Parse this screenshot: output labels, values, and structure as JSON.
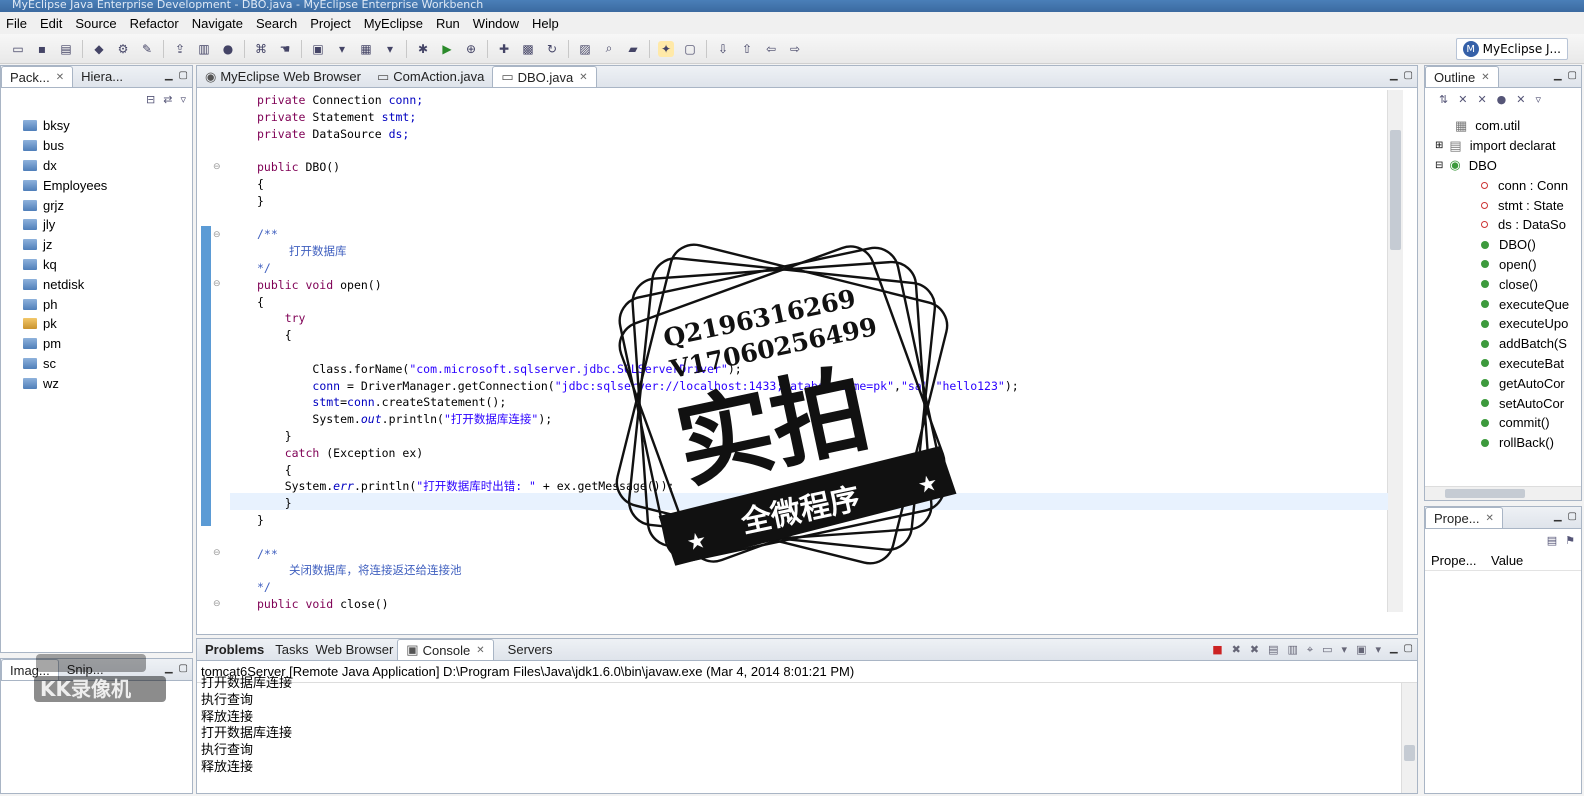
{
  "window": {
    "title": "MyEclipse Java Enterprise Development - DBO.java - MyEclipse Enterprise Workbench"
  },
  "menu": [
    "File",
    "Edit",
    "Source",
    "Refactor",
    "Navigate",
    "Search",
    "Project",
    "MyEclipse",
    "Run",
    "Window",
    "Help"
  ],
  "perspective": {
    "label": "MyEclipse J..."
  },
  "left_panel": {
    "tabs": [
      {
        "label": "Pack..."
      },
      {
        "label": "Hiera..."
      }
    ],
    "projects": [
      "bksy",
      "bus",
      "dx",
      "Employees",
      "grjz",
      "jly",
      "jz",
      "kq",
      "netdisk",
      "ph",
      "pk",
      "pm",
      "sc",
      "wz"
    ]
  },
  "left_bottom": {
    "tab1": "Imag...",
    "tab2": "Snip..."
  },
  "editor": {
    "tabs": [
      {
        "label": "MyEclipse Web Browser"
      },
      {
        "label": "ComAction.java"
      },
      {
        "label": "DBO.java"
      }
    ],
    "lines": {
      "l1a": "private ",
      "l1b": "Connection ",
      "l1c": "conn;",
      "l2a": "private ",
      "l2b": "Statement ",
      "l2c": "stmt;",
      "l3a": "private ",
      "l3b": "DataSource ",
      "l3c": "ds;",
      "l5a": "public ",
      "l5b": "DBO()",
      "l6": "{",
      "l7": "}",
      "l9": "/**",
      "l10": "打开数据库",
      "l11": "*/",
      "l12a": "public void ",
      "l12b": "open()",
      "l13": "{",
      "l14": "try",
      "l15": "{",
      "l17a": "Class.forName(",
      "l17b": "\"com.microsoft.sqlserver.jdbc.SQLServerDriver\"",
      "l17c": ");",
      "l18a": "conn",
      "l18b": " = DriverManager.getConnection(",
      "l18c": "\"jdbc:sqlserver://localhost:1433;DatabaseName=pk\"",
      "l18d": ",",
      "l18e": "\"sa\"",
      "l18f": ",",
      "l18g": "\"hello123\"",
      "l18h": ");",
      "l19a": "stmt",
      "l19b": "=",
      "l19c": "conn",
      "l19d": ".createStatement();",
      "l20a": "System.",
      "l20b": "out",
      "l20c": ".println(",
      "l20d": "\"打开数据库连接\"",
      "l20e": ");",
      "l21": "}",
      "l22a": "catch ",
      "l22b": "(Exception ex)",
      "l23": "{",
      "l24a": "System.",
      "l24b": "err",
      "l24c": ".println(",
      "l24d": "\"打开数据库时出错: \"",
      "l24e": " + ex.getMessage());",
      "l25": "}",
      "l26": "}",
      "l28": "/**",
      "l29": "关闭数据库，将连接返还给连接池",
      "l30": "*/",
      "l31a": "public void ",
      "l31b": "close()"
    }
  },
  "outline": {
    "tab": "Outline",
    "items": [
      "com.util",
      "import declarat",
      "DBO",
      "conn : Conn",
      "stmt : State",
      "ds : DataSo",
      "DBO()",
      "open()",
      "close()",
      "executeQue",
      "executeUpo",
      "addBatch(S",
      "executeBat",
      "getAutoCor",
      "setAutoCor",
      "commit()",
      "rollBack()"
    ]
  },
  "properties": {
    "tab": "Prope...",
    "col1": "Prope...",
    "col2": "Value"
  },
  "bottom": {
    "tabs": [
      {
        "label": "Problems"
      },
      {
        "label": "Tasks"
      },
      {
        "label": "Web Browser"
      },
      {
        "label": "Console"
      },
      {
        "label": "Servers"
      }
    ],
    "console_header": "tomcat6Server [Remote Java Application] D:\\Program Files\\Java\\jdk1.6.0\\bin\\javaw.exe (Mar 4, 2014 8:01:21 PM)",
    "console_lines": [
      "打开数据库连接",
      "执行查询",
      "释放连接",
      "打开数据库连接",
      "执行查询",
      "释放连接"
    ]
  },
  "watermark": {
    "line1": "Q2196316269",
    "line2": "V17060256499",
    "big": "实拍",
    "ribbon": "全微程序",
    "corner": "KK录像机"
  }
}
